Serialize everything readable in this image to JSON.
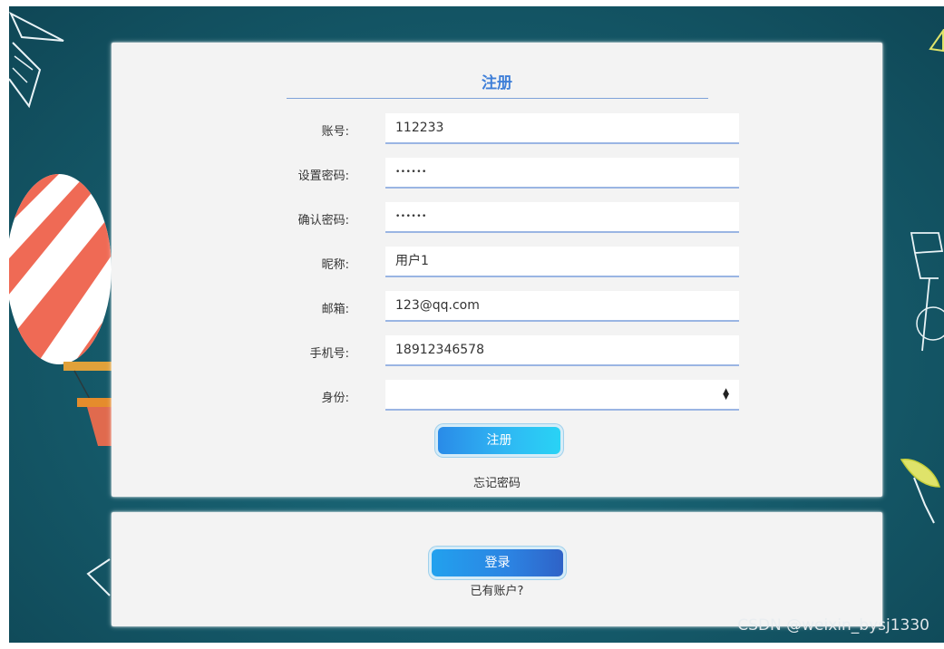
{
  "form": {
    "title": "注册",
    "fields": [
      {
        "label": "账号:",
        "value": "112233",
        "type": "text"
      },
      {
        "label": "设置密码:",
        "value": "••••••",
        "type": "password"
      },
      {
        "label": "确认密码:",
        "value": "••••••",
        "type": "password"
      },
      {
        "label": "昵称:",
        "value": "用户1",
        "type": "text"
      },
      {
        "label": "邮箱:",
        "value": "123@qq.com",
        "type": "text"
      },
      {
        "label": "手机号:",
        "value": "18912346578",
        "type": "text"
      },
      {
        "label": "身份:",
        "value": "",
        "type": "select"
      }
    ],
    "register_button": "注册",
    "forgot_password": "忘记密码"
  },
  "login": {
    "login_button": "登录",
    "have_account": "已有账户?"
  },
  "watermark": "CSDN @weixin_bysj1330",
  "colors": {
    "accent": "#3f7fd8",
    "background": "#155a6a",
    "card": "#f3f3f3"
  }
}
